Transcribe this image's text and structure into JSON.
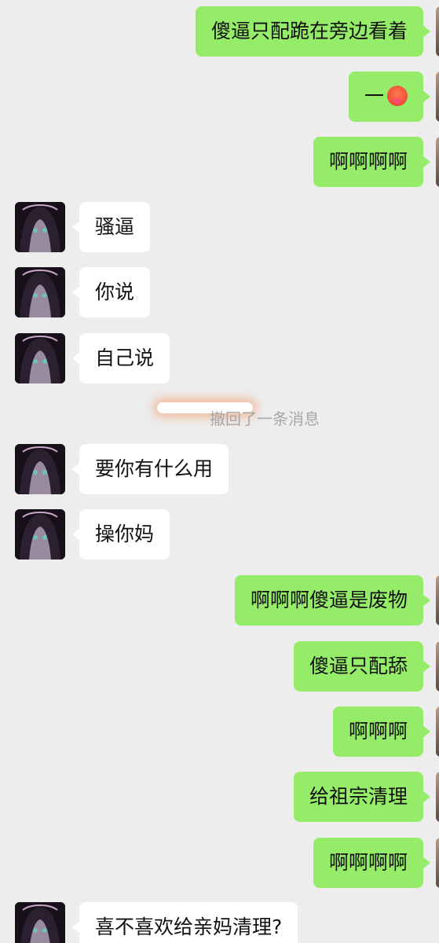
{
  "messages": [
    {
      "side": "out",
      "text": "傻逼只配跪在旁边看着"
    },
    {
      "side": "out",
      "text": "一",
      "emoji": "hot-face-emoji"
    },
    {
      "side": "out",
      "text": "啊啊啊啊"
    },
    {
      "side": "in",
      "text": "骚逼"
    },
    {
      "side": "in",
      "text": "你说"
    },
    {
      "side": "in",
      "text": "自己说"
    },
    {
      "side": "system",
      "text": "撤回了一条消息"
    },
    {
      "side": "in",
      "text": "要你有什么用"
    },
    {
      "side": "in",
      "text": "操你妈"
    },
    {
      "side": "out",
      "text": "啊啊啊傻逼是废物"
    },
    {
      "side": "out",
      "text": "傻逼只配舔"
    },
    {
      "side": "out",
      "text": "啊啊啊"
    },
    {
      "side": "out",
      "text": "给祖宗清理"
    },
    {
      "side": "out",
      "text": "啊啊啊啊"
    },
    {
      "side": "in",
      "text": "喜不喜欢给亲妈清理?"
    }
  ],
  "colors": {
    "background": "#ededed",
    "outgoing_bubble": "#95ec69",
    "incoming_bubble": "#ffffff",
    "system_text": "#a7a7a7"
  }
}
